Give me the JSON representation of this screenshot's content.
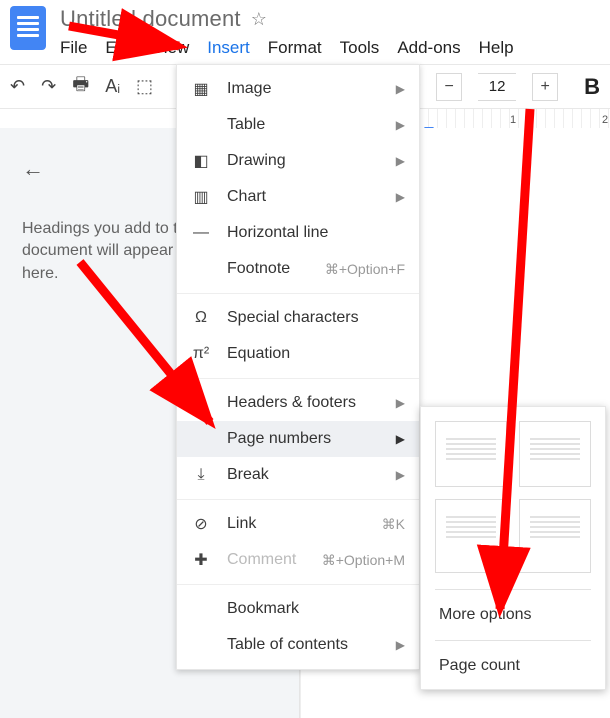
{
  "doc": {
    "title": "Untitled document"
  },
  "menubar": [
    "File",
    "Edit",
    "View",
    "Insert",
    "Format",
    "Tools",
    "Add-ons",
    "Help"
  ],
  "activeMenuIndex": 3,
  "toolbar": {
    "font_size": "12"
  },
  "ruler": {
    "n1": "1",
    "n2": "2"
  },
  "outline": {
    "hint": "Headings you add to the document will appear here."
  },
  "insert_menu": {
    "image": "Image",
    "table": "Table",
    "drawing": "Drawing",
    "chart": "Chart",
    "hr": "Horizontal line",
    "footnote": "Footnote",
    "footnote_sc": "⌘+Option+F",
    "specialchars": "Special characters",
    "equation": "Equation",
    "headers_footers": "Headers & footers",
    "page_numbers": "Page numbers",
    "break": "Break",
    "link": "Link",
    "link_sc": "⌘K",
    "comment": "Comment",
    "comment_sc": "⌘+Option+M",
    "bookmark": "Bookmark",
    "toc": "Table of contents"
  },
  "page_numbers_submenu": {
    "more_options": "More options",
    "page_count": "Page count"
  }
}
